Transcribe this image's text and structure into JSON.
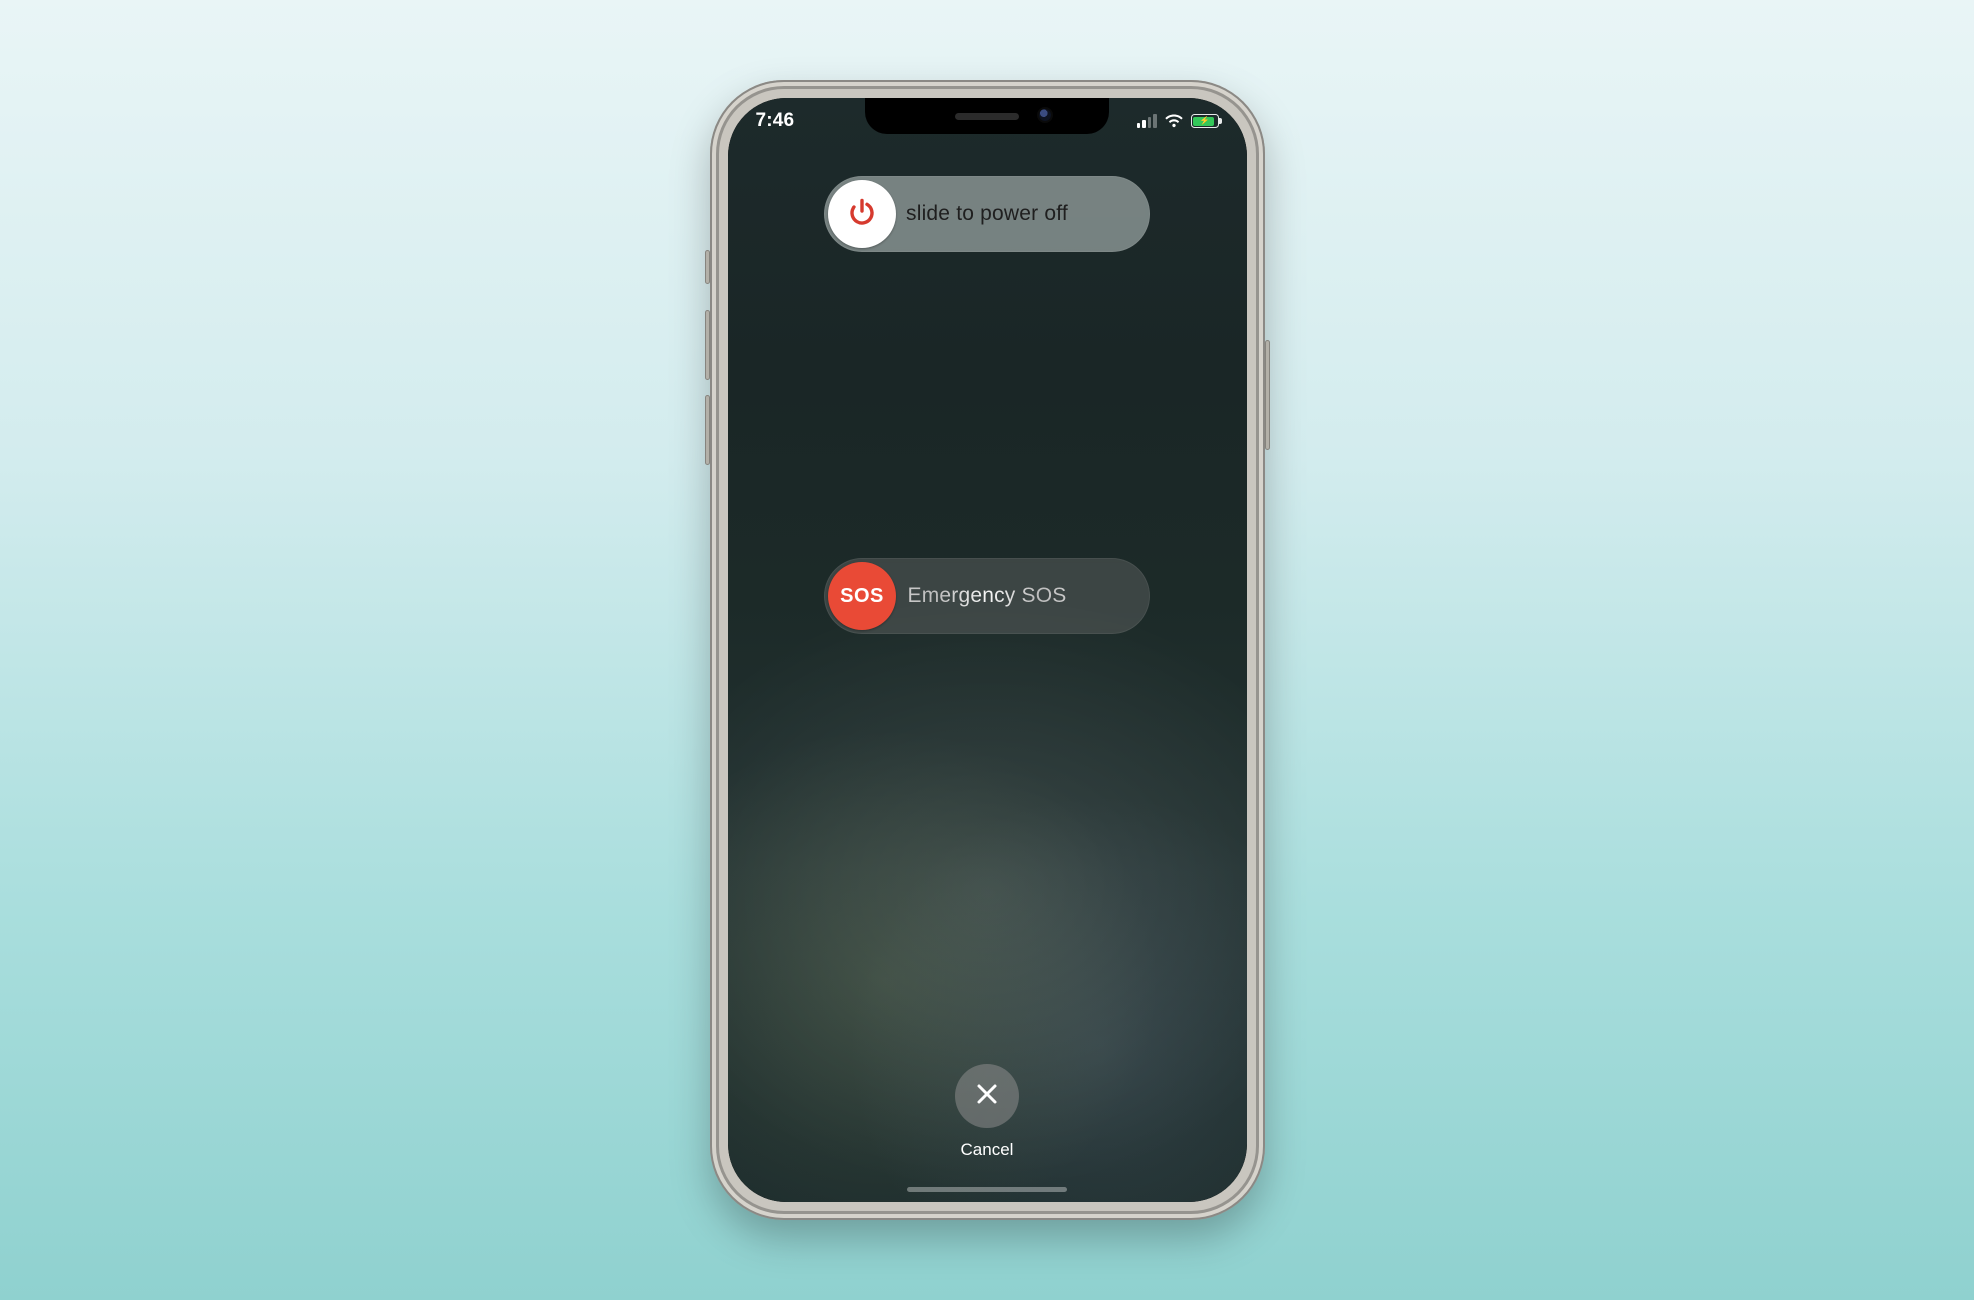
{
  "status": {
    "time": "7:46",
    "signal_bars_active": 2,
    "signal_bars_total": 4,
    "wifi_icon": "wifi-icon",
    "battery_charging": true,
    "battery_color": "#34c759"
  },
  "sliders": {
    "power": {
      "label": "slide to power off",
      "knob_icon": "power-icon",
      "knob_bg": "#ffffff",
      "icon_color": "#d63a2e"
    },
    "sos": {
      "label": "Emergency SOS",
      "knob_text": "SOS",
      "knob_bg": "#e94a36"
    }
  },
  "cancel": {
    "label": "Cancel",
    "icon": "close-icon"
  }
}
